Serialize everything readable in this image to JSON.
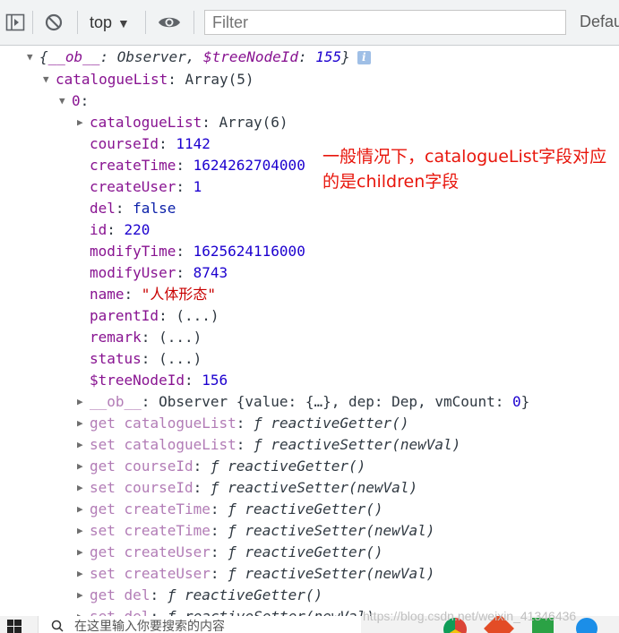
{
  "toolbar": {
    "context": "top",
    "filter_placeholder": "Filter",
    "levels": "Defau"
  },
  "tree": {
    "root": {
      "key1": "__ob__",
      "val1": "Observer",
      "key2": "$treeNodeId",
      "val2": "155"
    },
    "catalogue": {
      "key": "catalogueList",
      "type": "Array(5)"
    },
    "item0": {
      "key": "0"
    },
    "props": [
      {
        "key": "catalogueList",
        "value": "Array(6)",
        "kind": "plain",
        "expandable": true
      },
      {
        "key": "courseId",
        "value": "1142",
        "kind": "num"
      },
      {
        "key": "createTime",
        "value": "1624262704000",
        "kind": "num"
      },
      {
        "key": "createUser",
        "value": "1",
        "kind": "num"
      },
      {
        "key": "del",
        "value": "false",
        "kind": "bool"
      },
      {
        "key": "id",
        "value": "220",
        "kind": "num"
      },
      {
        "key": "modifyTime",
        "value": "1625624116000",
        "kind": "num"
      },
      {
        "key": "modifyUser",
        "value": "8743",
        "kind": "num"
      },
      {
        "key": "name",
        "value": "\"人体形态\"",
        "kind": "str"
      },
      {
        "key": "parentId",
        "value": "(...)",
        "kind": "plain"
      },
      {
        "key": "remark",
        "value": "(...)",
        "kind": "plain"
      },
      {
        "key": "status",
        "value": "(...)",
        "kind": "plain"
      },
      {
        "key": "$treeNodeId",
        "value": "156",
        "kind": "num"
      }
    ],
    "observer": {
      "key": "__ob__",
      "prefix": "Observer {value: {…}, dep: Dep, vmCount: ",
      "count": "0",
      "suffix": "}"
    },
    "accessors": [
      {
        "prefix": "get",
        "key": "catalogueList",
        "fn": "reactiveGetter()"
      },
      {
        "prefix": "set",
        "key": "catalogueList",
        "fn": "reactiveSetter(newVal)"
      },
      {
        "prefix": "get",
        "key": "courseId",
        "fn": "reactiveGetter()"
      },
      {
        "prefix": "set",
        "key": "courseId",
        "fn": "reactiveSetter(newVal)"
      },
      {
        "prefix": "get",
        "key": "createTime",
        "fn": "reactiveGetter()"
      },
      {
        "prefix": "set",
        "key": "createTime",
        "fn": "reactiveSetter(newVal)"
      },
      {
        "prefix": "get",
        "key": "createUser",
        "fn": "reactiveGetter()"
      },
      {
        "prefix": "set",
        "key": "createUser",
        "fn": "reactiveSetter(newVal)"
      },
      {
        "prefix": "get",
        "key": "del",
        "fn": "reactiveGetter()"
      },
      {
        "prefix": "set",
        "key": "del",
        "fn": "reactiveSetter(newVal)"
      }
    ]
  },
  "annotation": {
    "text": "一般情况下，catalogueList字段对应的是children字段",
    "color": "#e8160c"
  },
  "watermark": "https://blog.csdn.net/weixin_41346436",
  "taskbar": {
    "search_placeholder": "在这里输入你要搜索的内容"
  }
}
